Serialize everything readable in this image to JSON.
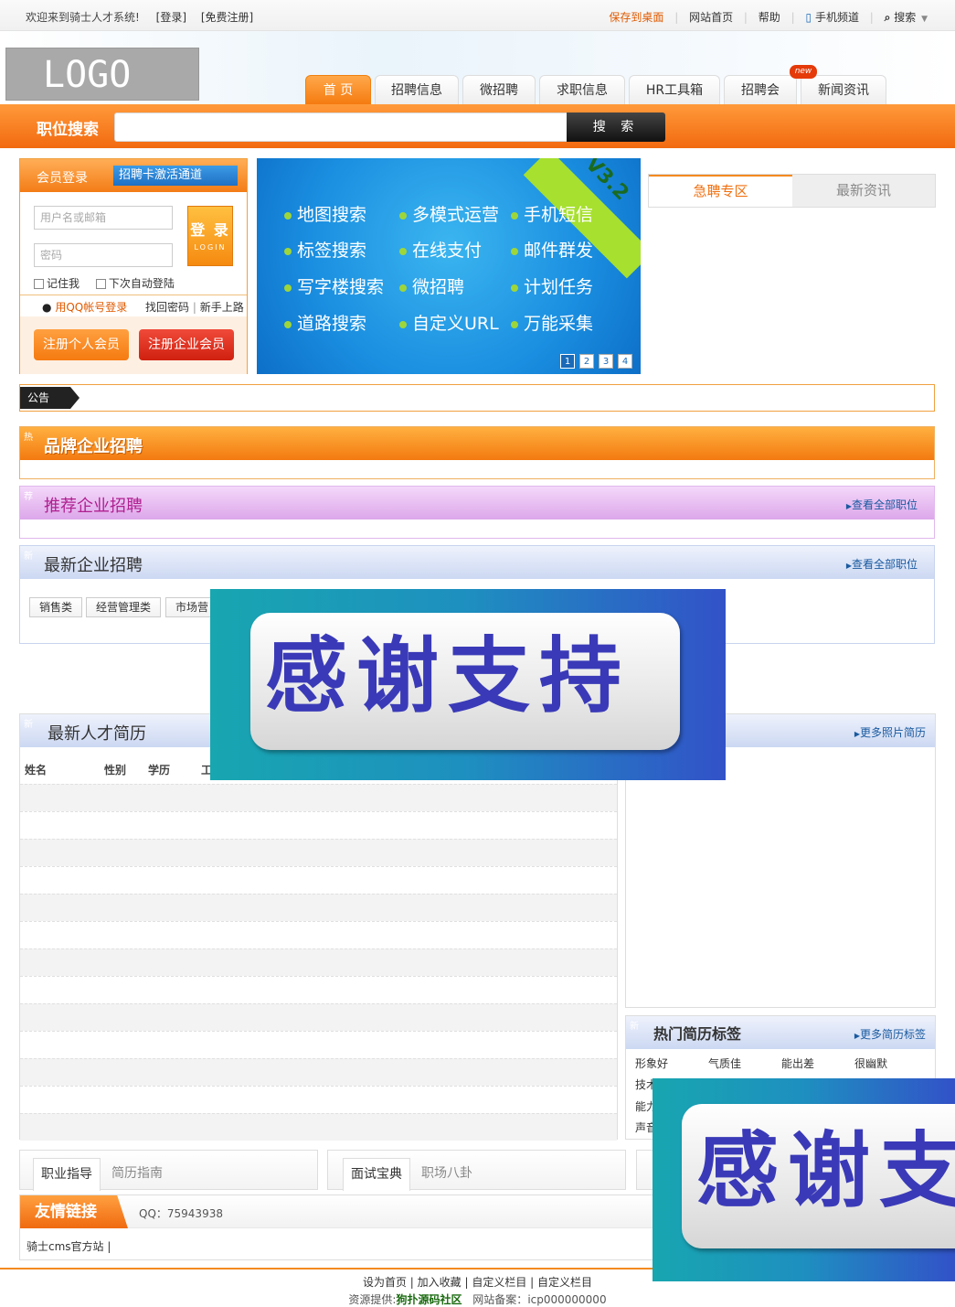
{
  "topbar": {
    "welcome": "欢迎来到骑士人才系统!",
    "login": "[登录]",
    "register": "[免费注册]",
    "save_desktop": "保存到桌面",
    "site_home": "网站首页",
    "help": "帮助",
    "mobile": "手机频道",
    "search": "搜索"
  },
  "logo": "LOGO",
  "nav": {
    "items": [
      "首 页",
      "招聘信息",
      "微招聘",
      "求职信息",
      "HR工具箱",
      "招聘会",
      "新闻资讯"
    ],
    "active_index": 0,
    "new_badge": "new"
  },
  "search": {
    "label": "职位搜索",
    "button": "搜 索"
  },
  "login": {
    "tab_member": "会员登录",
    "tab_card": "招聘卡激活通道",
    "username_placeholder": "用户名或邮箱",
    "password_placeholder": "密码",
    "login_button": "登 录",
    "login_button_sub": "LOGIN",
    "remember": "记住我",
    "auto_login": "下次自动登陆",
    "qq_login": "用QQ帐号登录",
    "find_password": "找回密码",
    "newbie": "新手上路",
    "reg_personal": "注册个人会员",
    "reg_company": "注册企业会员"
  },
  "banner": {
    "version": "V3.2",
    "features": [
      [
        "地图搜索",
        "多模式运营",
        "手机短信"
      ],
      [
        "标签搜索",
        "在线支付",
        "邮件群发"
      ],
      [
        "写字楼搜索",
        "微招聘",
        "计划任务"
      ],
      [
        "道路搜索",
        "自定义URL",
        "万能采集"
      ]
    ],
    "pages": [
      "1",
      "2",
      "3",
      "4"
    ]
  },
  "right_tabs": {
    "urgent": "急聘专区",
    "news": "最新资讯"
  },
  "notice": {
    "label": "公告"
  },
  "sections": {
    "brand": {
      "corner": "热",
      "title": "品牌企业招聘"
    },
    "recommend": {
      "corner": "荐",
      "title": "推荐企业招聘",
      "more": "查看全部职位"
    },
    "latest": {
      "corner": "新",
      "title": "最新企业招聘",
      "more": "查看全部职位",
      "tags": [
        "销售类",
        "经营管理类",
        "市场营"
      ]
    }
  },
  "resumes": {
    "corner": "新",
    "title": "最新人才简历",
    "columns": [
      "姓名",
      "性别",
      "学历",
      "工"
    ]
  },
  "photo_resumes": {
    "more": "更多照片简历"
  },
  "hot_tags": {
    "corner": "新",
    "title": "热门简历标签",
    "more": "更多简历标签",
    "row1": [
      "形象好",
      "气质佳",
      "能出差",
      "很幽默"
    ],
    "row2": [
      "技术",
      "能力",
      "声音"
    ]
  },
  "bottom_tabs": {
    "left": {
      "active": "职业指导",
      "inactive": "简历指南"
    },
    "right": {
      "active": "面试宝典",
      "inactive": "职场八卦"
    }
  },
  "links": {
    "label": "友情链接",
    "qq": "QQ：75943938",
    "items": "骑士cms官方站 |"
  },
  "footer": {
    "line1": "设为首页 | 加入收藏 | 自定义栏目 | 自定义栏目",
    "provider_label": "资源提供:",
    "provider": "狗扑源码社区",
    "icp_label": "网站备案：",
    "icp": "icp000000000"
  },
  "overlay": {
    "text": "感谢支持",
    "text_partial": "感谢支"
  },
  "colors": {
    "orange": "#f37c16",
    "blue": "#1a8ee0",
    "purple_section": "#d9a3e8",
    "overlay_text": "#3a3ab8"
  }
}
